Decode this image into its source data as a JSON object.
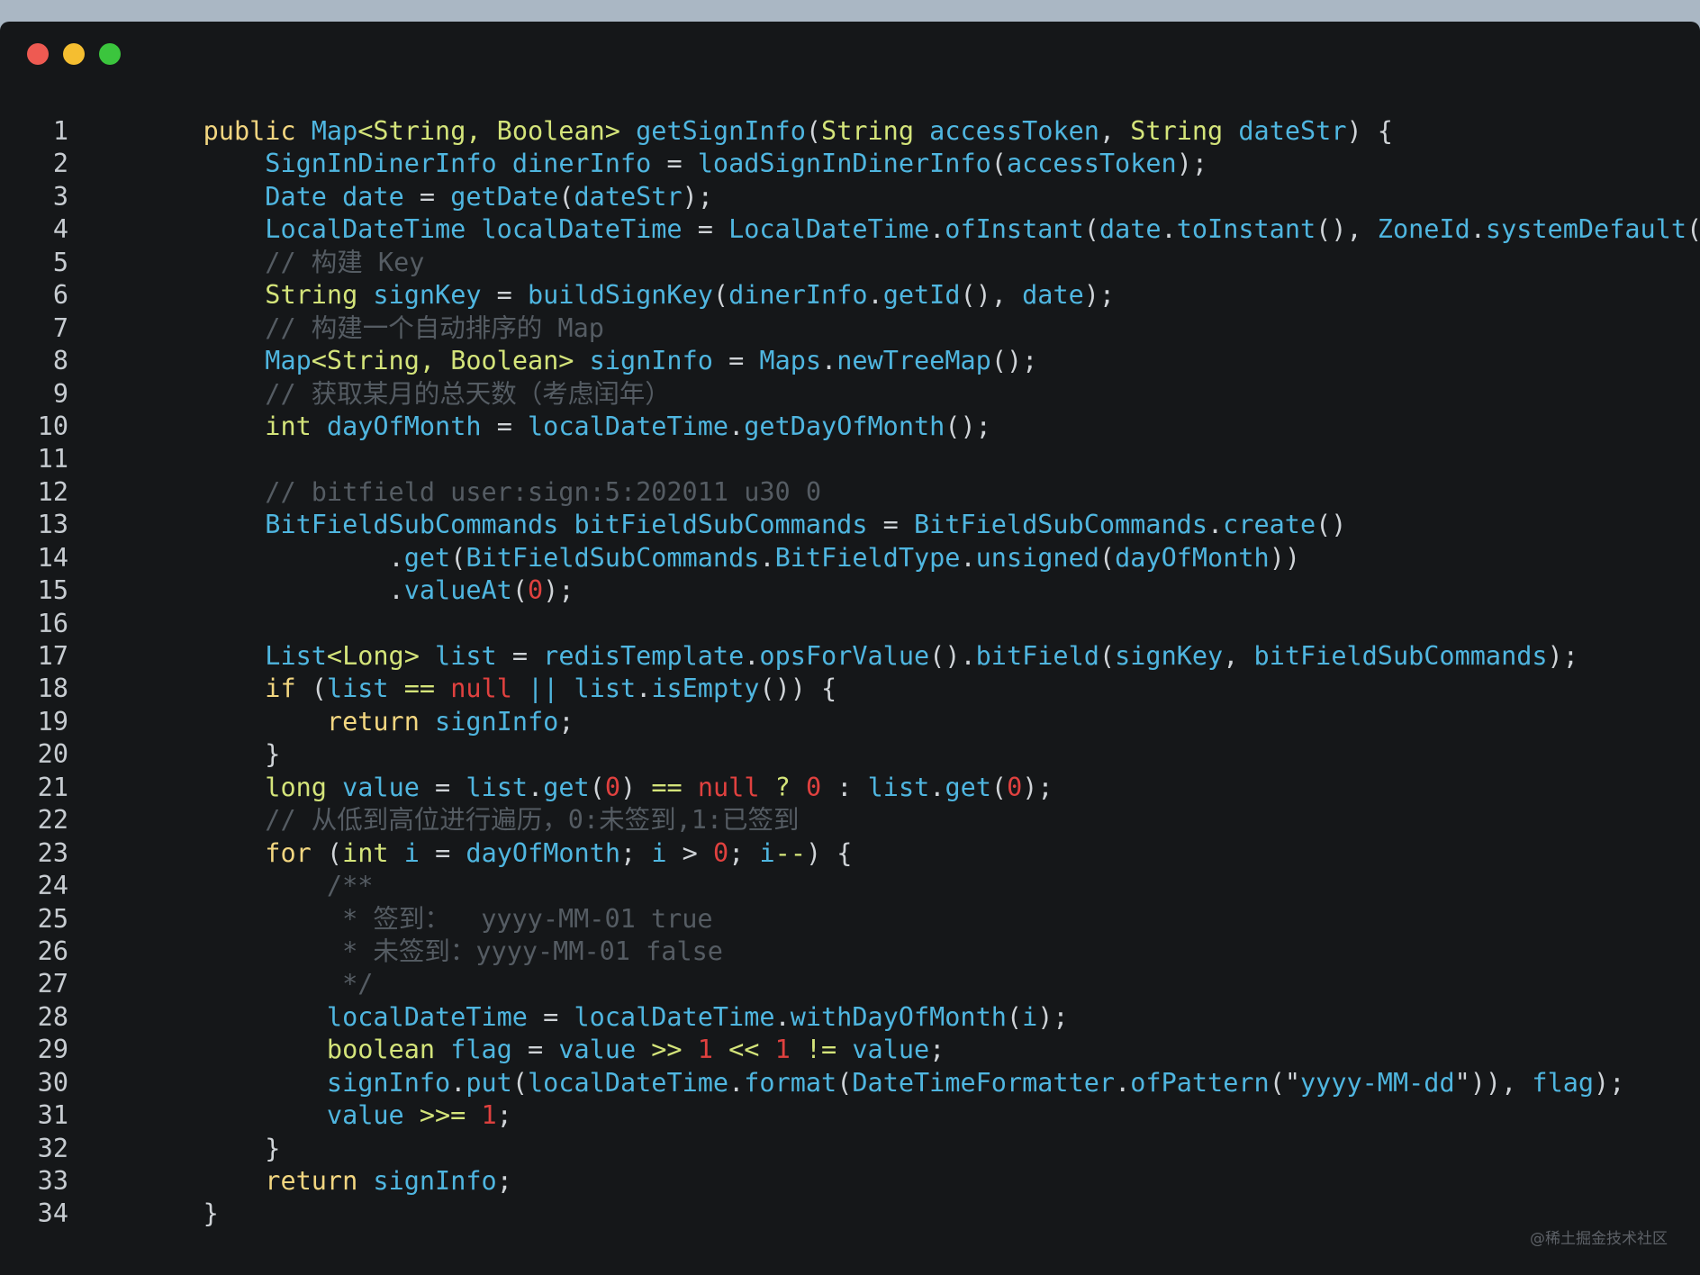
{
  "window": {
    "controls": [
      {
        "name": "close-button",
        "color": "#ee5a52"
      },
      {
        "name": "minimize-button",
        "color": "#f5be30"
      },
      {
        "name": "zoom-button",
        "color": "#3bc53d"
      }
    ]
  },
  "colors": {
    "keyword": "#f2d680",
    "type": "#d4e47a",
    "identifier": "#4fb6e0",
    "comment": "#555c63",
    "number": "#e0413f",
    "plain": "#cfd3d7",
    "background": "#151719"
  },
  "code_lines": [
    {
      "n": "1",
      "tokens": [
        [
          "    ",
          "plain"
        ],
        [
          "public",
          "keyword"
        ],
        [
          " ",
          "plain"
        ],
        [
          "Map",
          "ident"
        ],
        [
          "<String, Boolean>",
          "type"
        ],
        [
          " ",
          "plain"
        ],
        [
          "getSignInfo",
          "ident"
        ],
        [
          "(",
          "plain"
        ],
        [
          "String",
          "type"
        ],
        [
          " ",
          "plain"
        ],
        [
          "accessToken",
          "ident"
        ],
        [
          ", ",
          "plain"
        ],
        [
          "String",
          "type"
        ],
        [
          " ",
          "plain"
        ],
        [
          "dateStr",
          "ident"
        ],
        [
          ") {",
          "plain"
        ]
      ]
    },
    {
      "n": "2",
      "tokens": [
        [
          "        ",
          "plain"
        ],
        [
          "SignInDinerInfo",
          "ident"
        ],
        [
          " ",
          "plain"
        ],
        [
          "dinerInfo",
          "ident"
        ],
        [
          " = ",
          "plain"
        ],
        [
          "loadSignInDinerInfo",
          "ident"
        ],
        [
          "(",
          "plain"
        ],
        [
          "accessToken",
          "ident"
        ],
        [
          ");",
          "plain"
        ]
      ]
    },
    {
      "n": "3",
      "tokens": [
        [
          "        ",
          "plain"
        ],
        [
          "Date",
          "ident"
        ],
        [
          " ",
          "plain"
        ],
        [
          "date",
          "ident"
        ],
        [
          " = ",
          "plain"
        ],
        [
          "getDate",
          "ident"
        ],
        [
          "(",
          "plain"
        ],
        [
          "dateStr",
          "ident"
        ],
        [
          ");",
          "plain"
        ]
      ]
    },
    {
      "n": "4",
      "tokens": [
        [
          "        ",
          "plain"
        ],
        [
          "LocalDateTime",
          "ident"
        ],
        [
          " ",
          "plain"
        ],
        [
          "localDateTime",
          "ident"
        ],
        [
          " = ",
          "plain"
        ],
        [
          "LocalDateTime",
          "ident"
        ],
        [
          ".",
          "plain"
        ],
        [
          "ofInstant",
          "ident"
        ],
        [
          "(",
          "plain"
        ],
        [
          "date",
          "ident"
        ],
        [
          ".",
          "plain"
        ],
        [
          "toInstant",
          "ident"
        ],
        [
          "(), ",
          "plain"
        ],
        [
          "ZoneId",
          "ident"
        ],
        [
          ".",
          "plain"
        ],
        [
          "systemDefault",
          "ident"
        ],
        [
          "());",
          "plain"
        ]
      ]
    },
    {
      "n": "5",
      "tokens": [
        [
          "        ",
          "plain"
        ],
        [
          "// 构建 Key",
          "comment"
        ]
      ]
    },
    {
      "n": "6",
      "tokens": [
        [
          "        ",
          "plain"
        ],
        [
          "String",
          "type"
        ],
        [
          " ",
          "plain"
        ],
        [
          "signKey",
          "ident"
        ],
        [
          " = ",
          "plain"
        ],
        [
          "buildSignKey",
          "ident"
        ],
        [
          "(",
          "plain"
        ],
        [
          "dinerInfo",
          "ident"
        ],
        [
          ".",
          "plain"
        ],
        [
          "getId",
          "ident"
        ],
        [
          "(), ",
          "plain"
        ],
        [
          "date",
          "ident"
        ],
        [
          ");",
          "plain"
        ]
      ]
    },
    {
      "n": "7",
      "tokens": [
        [
          "        ",
          "plain"
        ],
        [
          "// 构建一个自动排序的 Map",
          "comment"
        ]
      ]
    },
    {
      "n": "8",
      "tokens": [
        [
          "        ",
          "plain"
        ],
        [
          "Map",
          "ident"
        ],
        [
          "<String, Boolean>",
          "type"
        ],
        [
          " ",
          "plain"
        ],
        [
          "signInfo",
          "ident"
        ],
        [
          " = ",
          "plain"
        ],
        [
          "Maps",
          "ident"
        ],
        [
          ".",
          "plain"
        ],
        [
          "newTreeMap",
          "ident"
        ],
        [
          "();",
          "plain"
        ]
      ]
    },
    {
      "n": "9",
      "tokens": [
        [
          "        ",
          "plain"
        ],
        [
          "// 获取某月的总天数（考虑闰年）",
          "comment"
        ]
      ]
    },
    {
      "n": "10",
      "tokens": [
        [
          "        ",
          "plain"
        ],
        [
          "int",
          "type"
        ],
        [
          " ",
          "plain"
        ],
        [
          "dayOfMonth",
          "ident"
        ],
        [
          " = ",
          "plain"
        ],
        [
          "localDateTime",
          "ident"
        ],
        [
          ".",
          "plain"
        ],
        [
          "getDayOfMonth",
          "ident"
        ],
        [
          "();",
          "plain"
        ]
      ]
    },
    {
      "n": "11",
      "tokens": []
    },
    {
      "n": "12",
      "tokens": [
        [
          "        ",
          "plain"
        ],
        [
          "// bitfield user:sign:5:202011 u30 0",
          "comment"
        ]
      ]
    },
    {
      "n": "13",
      "tokens": [
        [
          "        ",
          "plain"
        ],
        [
          "BitFieldSubCommands",
          "ident"
        ],
        [
          " ",
          "plain"
        ],
        [
          "bitFieldSubCommands",
          "ident"
        ],
        [
          " = ",
          "plain"
        ],
        [
          "BitFieldSubCommands",
          "ident"
        ],
        [
          ".",
          "plain"
        ],
        [
          "create",
          "ident"
        ],
        [
          "()",
          "plain"
        ]
      ]
    },
    {
      "n": "14",
      "tokens": [
        [
          "                ",
          "plain"
        ],
        [
          ".",
          "plain"
        ],
        [
          "get",
          "ident"
        ],
        [
          "(",
          "plain"
        ],
        [
          "BitFieldSubCommands",
          "ident"
        ],
        [
          ".",
          "plain"
        ],
        [
          "BitFieldType",
          "ident"
        ],
        [
          ".",
          "plain"
        ],
        [
          "unsigned",
          "ident"
        ],
        [
          "(",
          "plain"
        ],
        [
          "dayOfMonth",
          "ident"
        ],
        [
          "))",
          "plain"
        ]
      ]
    },
    {
      "n": "15",
      "tokens": [
        [
          "                ",
          "plain"
        ],
        [
          ".",
          "plain"
        ],
        [
          "valueAt",
          "ident"
        ],
        [
          "(",
          "plain"
        ],
        [
          "0",
          "number"
        ],
        [
          ");",
          "plain"
        ]
      ]
    },
    {
      "n": "16",
      "tokens": []
    },
    {
      "n": "17",
      "tokens": [
        [
          "        ",
          "plain"
        ],
        [
          "List",
          "ident"
        ],
        [
          "<Long>",
          "type"
        ],
        [
          " ",
          "plain"
        ],
        [
          "list",
          "ident"
        ],
        [
          " = ",
          "plain"
        ],
        [
          "redisTemplate",
          "ident"
        ],
        [
          ".",
          "plain"
        ],
        [
          "opsForValue",
          "ident"
        ],
        [
          "().",
          "plain"
        ],
        [
          "bitField",
          "ident"
        ],
        [
          "(",
          "plain"
        ],
        [
          "signKey",
          "ident"
        ],
        [
          ", ",
          "plain"
        ],
        [
          "bitFieldSubCommands",
          "ident"
        ],
        [
          ");",
          "plain"
        ]
      ]
    },
    {
      "n": "18",
      "tokens": [
        [
          "        ",
          "plain"
        ],
        [
          "if",
          "keyword"
        ],
        [
          " (",
          "plain"
        ],
        [
          "list",
          "ident"
        ],
        [
          " == ",
          "type"
        ],
        [
          "null",
          "literal"
        ],
        [
          " || ",
          "ident"
        ],
        [
          "list",
          "ident"
        ],
        [
          ".",
          "plain"
        ],
        [
          "isEmpty",
          "ident"
        ],
        [
          "()) {",
          "plain"
        ]
      ]
    },
    {
      "n": "19",
      "tokens": [
        [
          "            ",
          "plain"
        ],
        [
          "return",
          "keyword"
        ],
        [
          " ",
          "plain"
        ],
        [
          "signInfo",
          "ident"
        ],
        [
          ";",
          "plain"
        ]
      ]
    },
    {
      "n": "20",
      "tokens": [
        [
          "        ",
          "plain"
        ],
        [
          "}",
          "plain"
        ]
      ]
    },
    {
      "n": "21",
      "tokens": [
        [
          "        ",
          "plain"
        ],
        [
          "long",
          "type"
        ],
        [
          " ",
          "plain"
        ],
        [
          "value",
          "ident"
        ],
        [
          " = ",
          "plain"
        ],
        [
          "list",
          "ident"
        ],
        [
          ".",
          "plain"
        ],
        [
          "get",
          "ident"
        ],
        [
          "(",
          "plain"
        ],
        [
          "0",
          "number"
        ],
        [
          ") ",
          "plain"
        ],
        [
          "==",
          "type"
        ],
        [
          " ",
          "plain"
        ],
        [
          "null",
          "literal"
        ],
        [
          " ? ",
          "type"
        ],
        [
          "0",
          "number"
        ],
        [
          " : ",
          "plain"
        ],
        [
          "list",
          "ident"
        ],
        [
          ".",
          "plain"
        ],
        [
          "get",
          "ident"
        ],
        [
          "(",
          "plain"
        ],
        [
          "0",
          "number"
        ],
        [
          ");",
          "plain"
        ]
      ]
    },
    {
      "n": "22",
      "tokens": [
        [
          "        ",
          "plain"
        ],
        [
          "// 从低到高位进行遍历，0:未签到,1:已签到",
          "comment"
        ]
      ]
    },
    {
      "n": "23",
      "tokens": [
        [
          "        ",
          "plain"
        ],
        [
          "for",
          "keyword"
        ],
        [
          " (",
          "plain"
        ],
        [
          "int",
          "type"
        ],
        [
          " ",
          "plain"
        ],
        [
          "i",
          "ident"
        ],
        [
          " = ",
          "plain"
        ],
        [
          "dayOfMonth",
          "ident"
        ],
        [
          "; ",
          "plain"
        ],
        [
          "i",
          "ident"
        ],
        [
          " > ",
          "plain"
        ],
        [
          "0",
          "number"
        ],
        [
          "; ",
          "plain"
        ],
        [
          "i",
          "ident"
        ],
        [
          "--",
          "type"
        ],
        [
          ") {",
          "plain"
        ]
      ]
    },
    {
      "n": "24",
      "tokens": [
        [
          "            ",
          "plain"
        ],
        [
          "/**",
          "comment"
        ]
      ]
    },
    {
      "n": "25",
      "tokens": [
        [
          "             ",
          "plain"
        ],
        [
          "* 签到：  yyyy-MM-01 true",
          "comment"
        ]
      ]
    },
    {
      "n": "26",
      "tokens": [
        [
          "             ",
          "plain"
        ],
        [
          "* 未签到：yyyy-MM-01 false",
          "comment"
        ]
      ]
    },
    {
      "n": "27",
      "tokens": [
        [
          "             ",
          "plain"
        ],
        [
          "*/",
          "comment"
        ]
      ]
    },
    {
      "n": "28",
      "tokens": [
        [
          "            ",
          "plain"
        ],
        [
          "localDateTime",
          "ident"
        ],
        [
          " = ",
          "plain"
        ],
        [
          "localDateTime",
          "ident"
        ],
        [
          ".",
          "plain"
        ],
        [
          "withDayOfMonth",
          "ident"
        ],
        [
          "(",
          "plain"
        ],
        [
          "i",
          "ident"
        ],
        [
          ");",
          "plain"
        ]
      ]
    },
    {
      "n": "29",
      "tokens": [
        [
          "            ",
          "plain"
        ],
        [
          "boolean",
          "type"
        ],
        [
          " ",
          "plain"
        ],
        [
          "flag",
          "ident"
        ],
        [
          " = ",
          "plain"
        ],
        [
          "value",
          "ident"
        ],
        [
          " >> ",
          "type"
        ],
        [
          "1",
          "number"
        ],
        [
          " << ",
          "type"
        ],
        [
          "1",
          "number"
        ],
        [
          " != ",
          "type"
        ],
        [
          "value",
          "ident"
        ],
        [
          ";",
          "plain"
        ]
      ]
    },
    {
      "n": "30",
      "tokens": [
        [
          "            ",
          "plain"
        ],
        [
          "signInfo",
          "ident"
        ],
        [
          ".",
          "plain"
        ],
        [
          "put",
          "ident"
        ],
        [
          "(",
          "plain"
        ],
        [
          "localDateTime",
          "ident"
        ],
        [
          ".",
          "plain"
        ],
        [
          "format",
          "ident"
        ],
        [
          "(",
          "plain"
        ],
        [
          "DateTimeFormatter",
          "ident"
        ],
        [
          ".",
          "plain"
        ],
        [
          "ofPattern",
          "ident"
        ],
        [
          "(\"",
          "plain"
        ],
        [
          "yyyy-MM-dd",
          "ident"
        ],
        [
          "\")), ",
          "plain"
        ],
        [
          "flag",
          "ident"
        ],
        [
          ");",
          "plain"
        ]
      ]
    },
    {
      "n": "31",
      "tokens": [
        [
          "            ",
          "plain"
        ],
        [
          "value",
          "ident"
        ],
        [
          " >>= ",
          "type"
        ],
        [
          "1",
          "number"
        ],
        [
          ";",
          "plain"
        ]
      ]
    },
    {
      "n": "32",
      "tokens": [
        [
          "        ",
          "plain"
        ],
        [
          "}",
          "plain"
        ]
      ]
    },
    {
      "n": "33",
      "tokens": [
        [
          "        ",
          "plain"
        ],
        [
          "return",
          "keyword"
        ],
        [
          " ",
          "plain"
        ],
        [
          "signInfo",
          "ident"
        ],
        [
          ";",
          "plain"
        ]
      ]
    },
    {
      "n": "34",
      "tokens": [
        [
          "    ",
          "plain"
        ],
        [
          "}",
          "plain"
        ]
      ]
    }
  ],
  "watermark": "@稀土掘金技术社区"
}
